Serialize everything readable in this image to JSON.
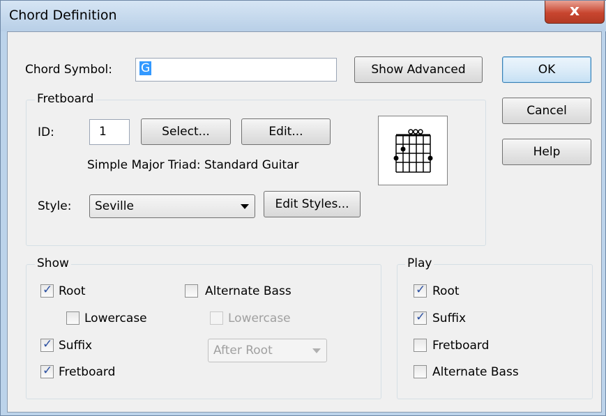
{
  "window": {
    "title": "Chord Definition",
    "close_glyph": "x"
  },
  "chord_symbol": {
    "label": "Chord Symbol:",
    "value": "G"
  },
  "buttons": {
    "show_advanced": "Show Advanced",
    "ok": "OK",
    "cancel": "Cancel",
    "help": "Help"
  },
  "fretboard": {
    "group_title": "Fretboard",
    "id_label": "ID:",
    "id_value": "1",
    "select_button": "Select...",
    "edit_button": "Edit...",
    "description": "Simple Major Triad: Standard Guitar",
    "style_label": "Style:",
    "style_value": "Seville",
    "edit_styles_button": "Edit Styles...",
    "diagram_icon": "guitar-chord-diagram"
  },
  "show": {
    "group_title": "Show",
    "root": {
      "label": "Root",
      "checked": true
    },
    "lowercase": {
      "label": "Lowercase",
      "checked": false
    },
    "suffix": {
      "label": "Suffix",
      "checked": true
    },
    "fretboard": {
      "label": "Fretboard",
      "checked": true
    },
    "alternate_bass": {
      "label": "Alternate Bass",
      "checked": false
    },
    "alt_lowercase": {
      "label": "Lowercase",
      "checked": false,
      "enabled": false
    },
    "alt_position": {
      "value": "After Root",
      "enabled": false
    }
  },
  "play": {
    "group_title": "Play",
    "root": {
      "label": "Root",
      "checked": true
    },
    "suffix": {
      "label": "Suffix",
      "checked": true
    },
    "fretboard": {
      "label": "Fretboard",
      "checked": false
    },
    "alternate_bass": {
      "label": "Alternate Bass",
      "checked": false
    }
  },
  "colors": {
    "title_bar": "#bcd3ea",
    "close_button": "#c8452f",
    "selection": "#3399ff",
    "check_mark": "#2b4fa0"
  }
}
